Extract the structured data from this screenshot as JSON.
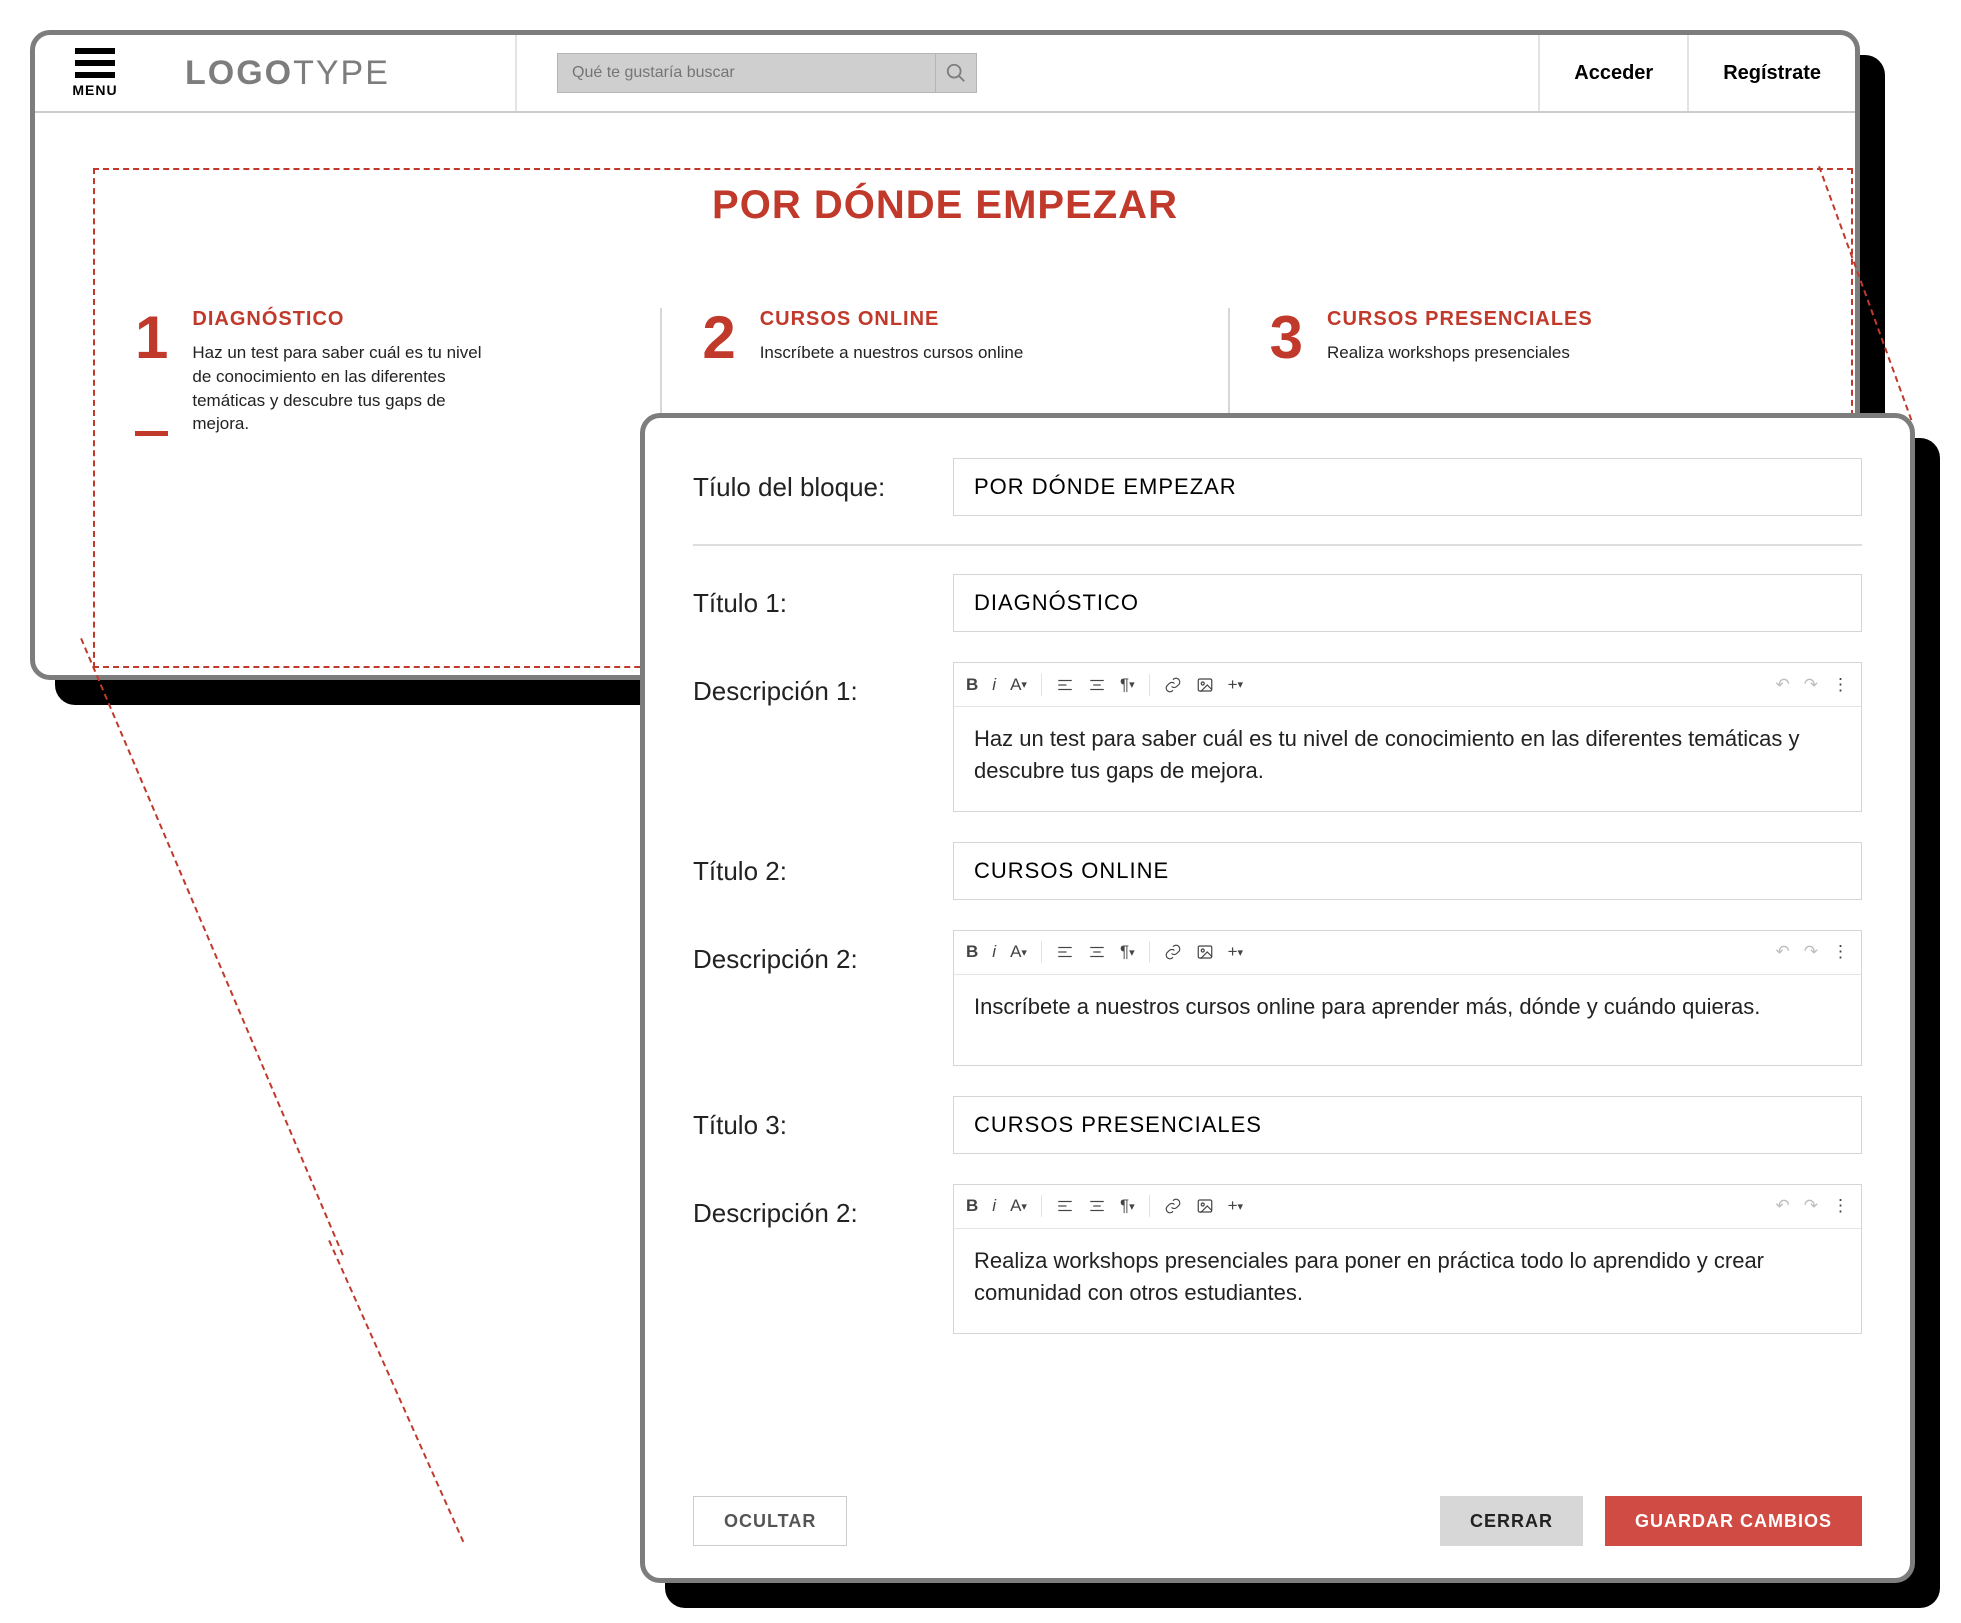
{
  "colors": {
    "accent": "#c0392b",
    "danger": "#cf4b44"
  },
  "header": {
    "menu_label": "MENU",
    "logo_bold": "LOGO",
    "logo_light": "TYPE",
    "search_placeholder": "Qué te gustaría buscar",
    "login": "Acceder",
    "signup": "Regístrate"
  },
  "preview": {
    "section_title": "POR DÓNDE EMPEZAR",
    "steps": [
      {
        "n": "1",
        "title": "DIAGNÓSTICO",
        "desc": "Haz un test para saber cuál es tu nivel de conocimiento en las diferentes temáticas y descubre tus gaps de mejora."
      },
      {
        "n": "2",
        "title": "CURSOS ONLINE",
        "desc": "Inscríbete a nuestros cursos online"
      },
      {
        "n": "3",
        "title": "CURSOS PRESENCIALES",
        "desc": "Realiza workshops presenciales"
      }
    ]
  },
  "editor": {
    "labels": {
      "block_title": "Tíulo del bloque:",
      "title1": "Título 1:",
      "desc1": "Descripción 1:",
      "title2": "Título 2:",
      "desc2": "Descripción 2:",
      "title3": "Título 3:",
      "desc3": "Descripción 2:"
    },
    "values": {
      "block_title": "POR DÓNDE EMPEZAR",
      "title1": "DIAGNÓSTICO",
      "desc1": "Haz un test para saber cuál es tu nivel de conocimiento en las diferentes temáticas y descubre tus gaps de mejora.",
      "title2": "CURSOS ONLINE",
      "desc2": "Inscríbete a nuestros cursos online para aprender más, dónde y cuándo quieras.",
      "title3": "CURSOS PRESENCIALES",
      "desc3": "Realiza workshops presenciales para poner en práctica todo lo aprendido y crear comunidad con otros estudiantes."
    },
    "toolbar": {
      "bold": "B",
      "italic": "i",
      "font": "A",
      "fontcaret": "▾",
      "undo": "↶",
      "redo": "↷",
      "more": "⋮"
    },
    "buttons": {
      "hide": "OCULTAR",
      "close": "CERRAR",
      "save": "GUARDAR CAMBIOS"
    }
  }
}
